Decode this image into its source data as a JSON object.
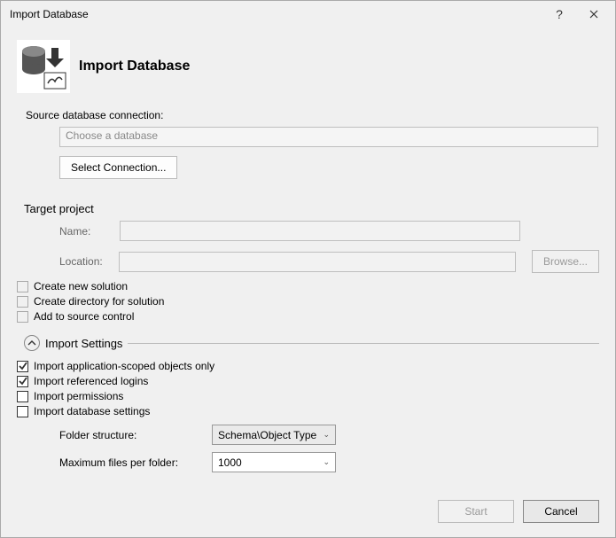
{
  "window": {
    "title": "Import Database"
  },
  "header": {
    "title": "Import Database"
  },
  "source": {
    "label": "Source database connection:",
    "placeholder": "Choose a database",
    "select_connection": "Select Connection..."
  },
  "target": {
    "section": "Target project",
    "name_label": "Name:",
    "name_value": "",
    "location_label": "Location:",
    "location_value": "",
    "browse": "Browse...",
    "create_new_solution": "Create new solution",
    "create_directory": "Create directory for solution",
    "add_source_control": "Add to source control"
  },
  "import": {
    "section": "Import Settings",
    "app_scoped": "Import application-scoped objects only",
    "ref_logins": "Import referenced logins",
    "permissions": "Import permissions",
    "db_settings": "Import database settings",
    "folder_structure_label": "Folder structure:",
    "folder_structure_value": "Schema\\Object Type",
    "max_files_label": "Maximum files per folder:",
    "max_files_value": "1000"
  },
  "footer": {
    "start": "Start",
    "cancel": "Cancel"
  }
}
